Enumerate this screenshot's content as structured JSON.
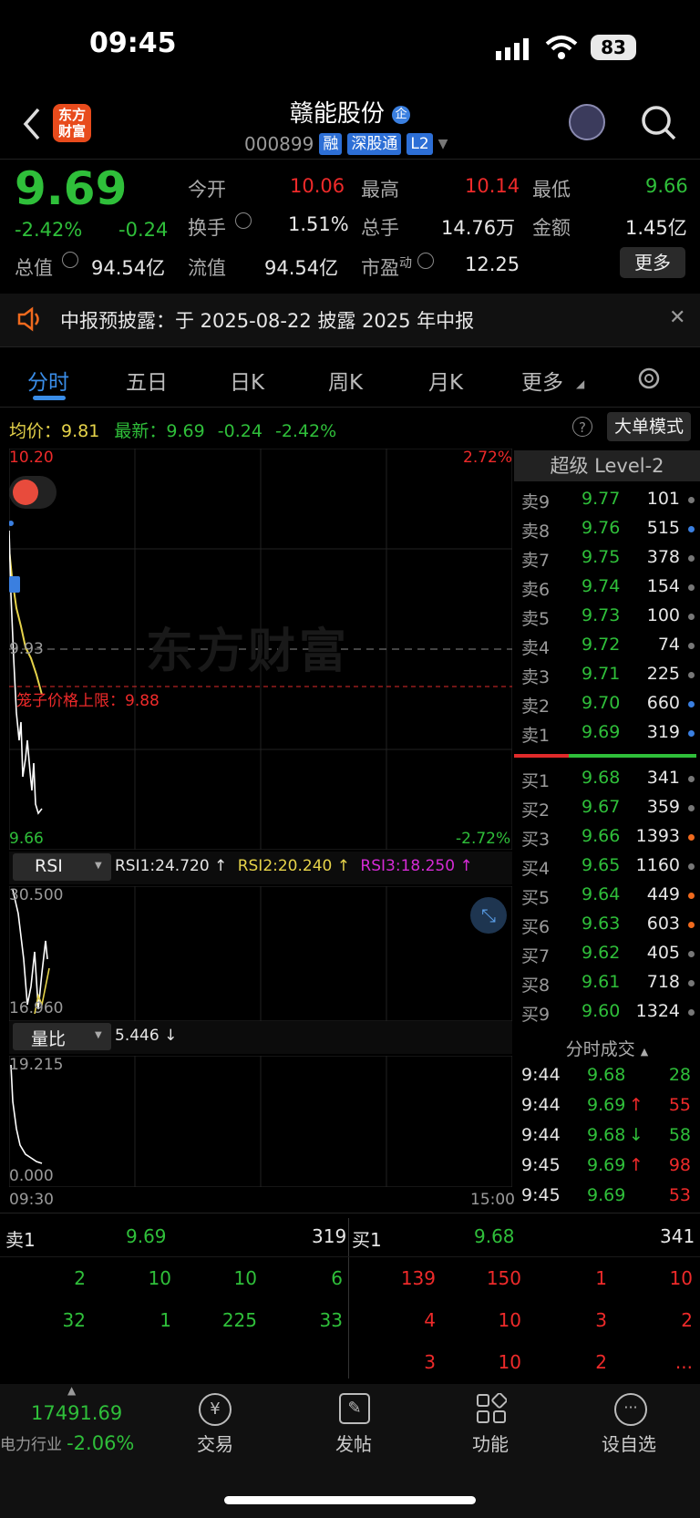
{
  "status": {
    "time": "09:45",
    "battery": "83"
  },
  "header": {
    "title": "赣能股份",
    "code": "000899",
    "badges": [
      "融",
      "深股通",
      "L2"
    ],
    "logo_text": "东方财富"
  },
  "quote": {
    "price": "9.69",
    "change_pct": "-2.42%",
    "change": "-0.24",
    "open_label": "今开",
    "open": "10.06",
    "high_label": "最高",
    "high": "10.14",
    "low_label": "最低",
    "low": "9.66",
    "turnover_label": "换手",
    "turnover": "1.51%",
    "volume_label": "总手",
    "volume": "14.76万",
    "amount_label": "金额",
    "amount": "1.45亿",
    "mktcap_label": "总值",
    "mktcap": "94.54亿",
    "float_label": "流值",
    "float": "94.54亿",
    "pe_label": "市盈",
    "pe_sup": "动",
    "pe": "12.25",
    "more": "更多"
  },
  "notice": {
    "text": "中报预披露：于 2025-08-22 披露 2025 年中报"
  },
  "tabs": [
    "分时",
    "五日",
    "日K",
    "周K",
    "月K",
    "更多"
  ],
  "info_line": {
    "avg_label": "均价：",
    "avg": "9.81",
    "latest_label": "最新：",
    "latest": "9.69",
    "chg": "-0.24",
    "chg_pct": "-2.42%",
    "big_order": "大单模式"
  },
  "chart": {
    "y_top": "10.20",
    "pct_top": "2.72%",
    "y_bottom": "9.66",
    "pct_bottom": "-2.72%",
    "ref": "9.93",
    "limit_label": "笼子价格上限：9.88",
    "watermark": "东方财富",
    "time_start": "09:30",
    "time_end": "15:00"
  },
  "rsi": {
    "selector": "RSI",
    "rsi1": "RSI1:24.720 ↑",
    "rsi2": "RSI2:20.240 ↑",
    "rsi3": "RSI3:18.250 ↑",
    "top": "30.500",
    "bottom": "16.960"
  },
  "volume_ratio": {
    "selector": "量比",
    "value": "5.446 ↓",
    "top": "19.215",
    "bottom": "0.000"
  },
  "orderbook": {
    "title": "超级 Level-2",
    "asks": [
      {
        "label": "卖9",
        "price": "9.77",
        "vol": "101",
        "dot": "#777"
      },
      {
        "label": "卖8",
        "price": "9.76",
        "vol": "515",
        "dot": "#3a7fe0"
      },
      {
        "label": "卖7",
        "price": "9.75",
        "vol": "378",
        "dot": "#777"
      },
      {
        "label": "卖6",
        "price": "9.74",
        "vol": "154",
        "dot": "#777"
      },
      {
        "label": "卖5",
        "price": "9.73",
        "vol": "100",
        "dot": "#777"
      },
      {
        "label": "卖4",
        "price": "9.72",
        "vol": "74",
        "dot": "#777"
      },
      {
        "label": "卖3",
        "price": "9.71",
        "vol": "225",
        "dot": "#777"
      },
      {
        "label": "卖2",
        "price": "9.70",
        "vol": "660",
        "dot": "#3a7fe0"
      },
      {
        "label": "卖1",
        "price": "9.69",
        "vol": "319",
        "dot": "#3a7fe0"
      }
    ],
    "bids": [
      {
        "label": "买1",
        "price": "9.68",
        "vol": "341",
        "dot": "#777"
      },
      {
        "label": "买2",
        "price": "9.67",
        "vol": "359",
        "dot": "#777"
      },
      {
        "label": "买3",
        "price": "9.66",
        "vol": "1393",
        "dot": "#f06a1e"
      },
      {
        "label": "买4",
        "price": "9.65",
        "vol": "1160",
        "dot": "#777"
      },
      {
        "label": "买5",
        "price": "9.64",
        "vol": "449",
        "dot": "#f06a1e"
      },
      {
        "label": "买6",
        "price": "9.63",
        "vol": "603",
        "dot": "#f06a1e"
      },
      {
        "label": "买7",
        "price": "9.62",
        "vol": "405",
        "dot": "#777"
      },
      {
        "label": "买8",
        "price": "9.61",
        "vol": "718",
        "dot": "#777"
      },
      {
        "label": "买9",
        "price": "9.60",
        "vol": "1324",
        "dot": "#777"
      }
    ]
  },
  "trades": {
    "title": "分时成交",
    "rows": [
      {
        "time": "9:44",
        "price": "9.68",
        "arrow": "",
        "vol": "28",
        "vcolor": "g"
      },
      {
        "time": "9:44",
        "price": "9.69",
        "arrow": "↑",
        "vol": "55",
        "vcolor": "r"
      },
      {
        "time": "9:44",
        "price": "9.68",
        "arrow": "↓",
        "vol": "58",
        "vcolor": "g"
      },
      {
        "time": "9:45",
        "price": "9.69",
        "arrow": "↑",
        "vol": "98",
        "vcolor": "r"
      },
      {
        "time": "9:45",
        "price": "9.69",
        "arrow": "",
        "vol": "53",
        "vcolor": "r"
      }
    ]
  },
  "queue": {
    "sell_label": "卖1",
    "sell_price": "9.69",
    "sell_vol": "319",
    "buy_label": "买1",
    "buy_price": "9.68",
    "buy_vol": "341",
    "sell_rows": [
      [
        "2",
        "10",
        "10",
        "6"
      ],
      [
        "32",
        "1",
        "225",
        "33"
      ]
    ],
    "buy_rows": [
      [
        "139",
        "150",
        "1",
        "10"
      ],
      [
        "4",
        "10",
        "3",
        "2"
      ],
      [
        "3",
        "10",
        "2",
        "..."
      ]
    ]
  },
  "bottom": {
    "index_value": "17491.69",
    "index_name": "电力行业",
    "index_chg": "-2.06%",
    "nav": [
      "交易",
      "发帖",
      "功能",
      "设自选"
    ]
  }
}
